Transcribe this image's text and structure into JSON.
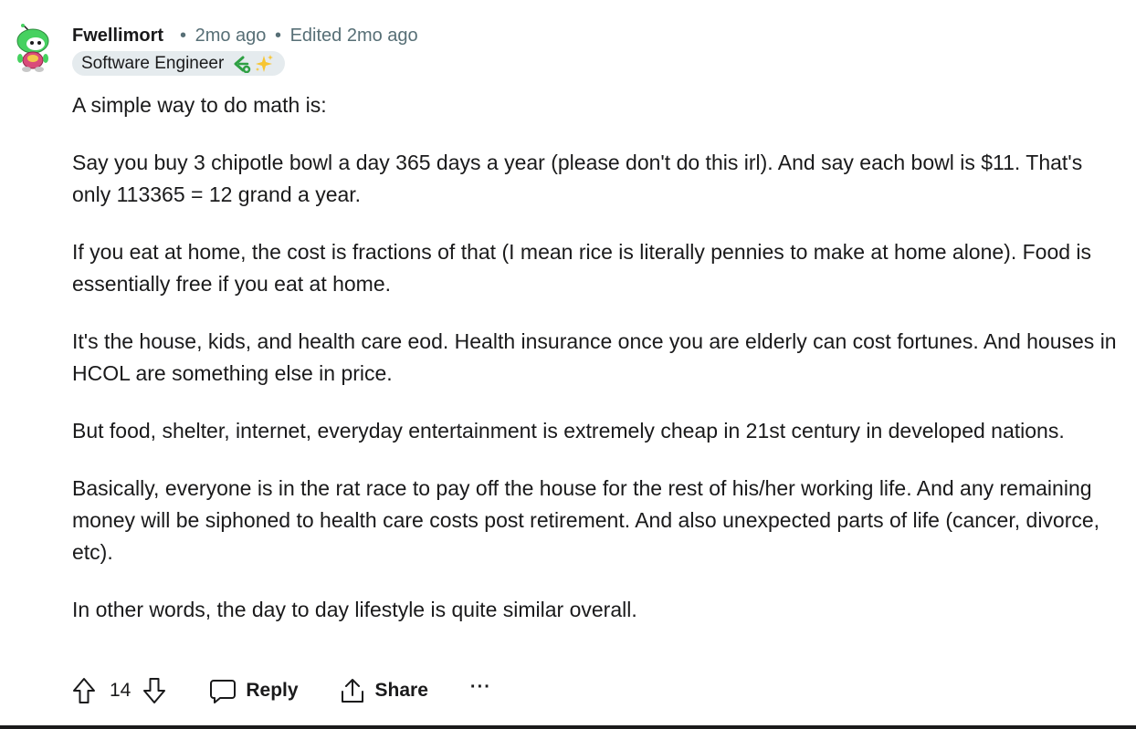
{
  "comment": {
    "author": "Fwellimort",
    "separator": "•",
    "time_ago": "2mo ago",
    "edited": "Edited 2mo ago",
    "flair": {
      "text": "Software Engineer",
      "emoji_icons": [
        "leetcode-icon",
        "sparkles-icon"
      ]
    },
    "paragraphs": [
      "A simple way to do math is:",
      "Say you buy 3 chipotle bowl a day 365 days a year (please don't do this irl). And say each bowl is $11. That's only 113365 = 12 grand a year.",
      "If you eat at home, the cost is fractions of that (I mean rice is literally pennies to make at home alone). Food is essentially free if you eat at home.",
      "It's the house, kids, and health care eod. Health insurance once you are elderly can cost fortunes. And houses in HCOL are something else in price.",
      "But food, shelter, internet, everyday entertainment is extremely cheap in 21st century in developed nations.",
      "Basically, everyone is in the rat race to pay off the house for the rest of his/her working life. And any remaining money will be siphoned to health care costs post retirement. And also unexpected parts of life (cancer, divorce, etc).",
      "In other words, the day to day lifestyle is quite similar overall."
    ],
    "actions": {
      "vote_count": "14",
      "reply_label": "Reply",
      "share_label": "Share",
      "more_label": "···"
    }
  },
  "colors": {
    "text": "#1a1a1b",
    "meta": "#576f76",
    "flair_bg": "#e5ebee",
    "avatar_green": "#46d160"
  }
}
